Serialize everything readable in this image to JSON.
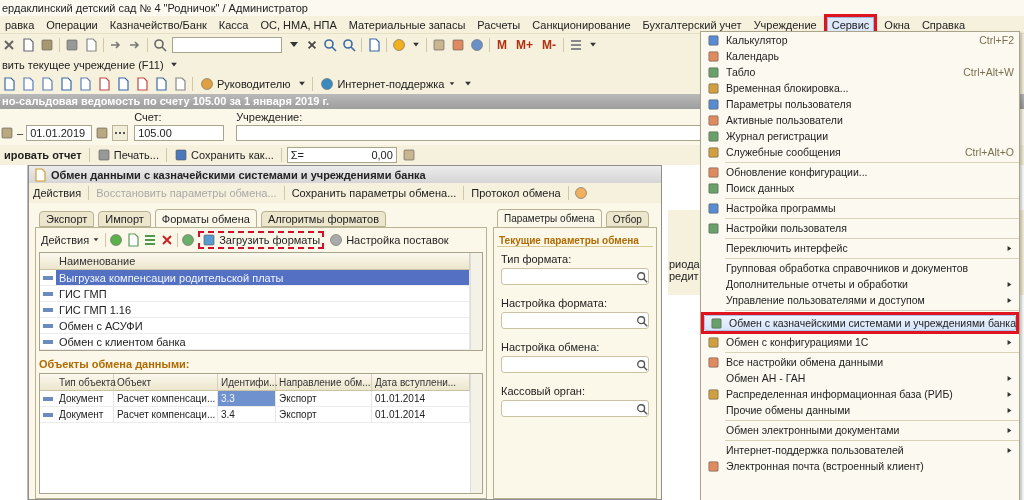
{
  "window": {
    "title": "ердаклинский детский сад № 4 \"Родничок\" / Администратор"
  },
  "menu_bar": [
    {
      "label": "равка",
      "selected": false,
      "annotated": false
    },
    {
      "label": "Операции",
      "selected": false,
      "annotated": false
    },
    {
      "label": "Казначейство/Банк",
      "selected": false,
      "annotated": false
    },
    {
      "label": "Касса",
      "selected": false,
      "annotated": false
    },
    {
      "label": "ОС, НМА, НПА",
      "selected": false,
      "annotated": false
    },
    {
      "label": "Материальные запасы",
      "selected": false,
      "annotated": false
    },
    {
      "label": "Расчеты",
      "selected": false,
      "annotated": false
    },
    {
      "label": "Санкционирование",
      "selected": false,
      "annotated": false
    },
    {
      "label": "Бухгалтерский учет",
      "selected": false,
      "annotated": false
    },
    {
      "label": "Учреждение",
      "selected": false,
      "annotated": false
    },
    {
      "label": "Сервис",
      "selected": true,
      "annotated": true
    },
    {
      "label": "Окна",
      "selected": false,
      "annotated": false
    },
    {
      "label": "Справка",
      "selected": false,
      "annotated": false
    }
  ],
  "toolbar": {
    "memory_buttons": [
      "M",
      "M+",
      "M-"
    ]
  },
  "institution_bar": {
    "label": "вить текущее учреждение (F11)"
  },
  "toolbar_2": {
    "buttons": [
      "Руководителю",
      "Интернет-поддержка"
    ]
  },
  "report": {
    "title": "но-сальдовая ведомость по счету 105.00 за 1 января 2019 г.",
    "period_separator": "–",
    "period_end": "01.01.2019",
    "account_label": "Счет:",
    "account": "105.00",
    "institution_label": "Учреждение:",
    "generate": "ировать отчет",
    "print": "Печать...",
    "save": "Сохранить как...",
    "sum_label": "Σ=",
    "sum": "0,00",
    "columns": [
      "риода",
      "редит"
    ]
  },
  "dialog": {
    "title": "Обмен данными с казначейскими системами и учреждениями банка",
    "toolbar": [
      {
        "label": "Действия",
        "disabled": false
      },
      {
        "label": "Восстановить параметры обмена...",
        "disabled": true
      },
      {
        "label": "Сохранить параметры обмена...",
        "disabled": false
      },
      {
        "label": "Протокол обмена",
        "disabled": false
      }
    ],
    "tabs": [
      {
        "label": "Экспорт",
        "selected": false
      },
      {
        "label": "Импорт",
        "selected": false
      },
      {
        "label": "Форматы обмена",
        "selected": true
      },
      {
        "label": "Алгоритмы форматов",
        "selected": false
      }
    ],
    "formats_toolbar": {
      "actions": "Действия",
      "load": "Загрузить форматы",
      "load_annotated": true,
      "delivery": "Настройка поставок"
    },
    "formats_table": {
      "column": "Наименование",
      "rows": [
        {
          "name": "Выгрузка компенсации родительской платы",
          "selected": true
        },
        {
          "name": "ГИС ГМП",
          "selected": false
        },
        {
          "name": "ГИС ГМП 1.16",
          "selected": false
        },
        {
          "name": "Обмен с АСУФИ",
          "selected": false
        },
        {
          "name": "Обмен с клиентом банка",
          "selected": false
        }
      ]
    },
    "objects_title": "Объекты обмена данными:",
    "objects_table": {
      "columns": [
        "Тип объекта",
        "Объект",
        "Идентифи...",
        "Направление обм...",
        "Дата вступлени..."
      ],
      "rows": [
        {
          "cells": [
            "Документ",
            "Расчет компенсаци...",
            "3.3",
            "Экспорт",
            "01.01.2014"
          ],
          "selected": true
        },
        {
          "cells": [
            "Документ",
            "Расчет компенсаци...",
            "3.4",
            "Экспорт",
            "01.01.2014"
          ],
          "selected": false
        }
      ]
    },
    "side_tabs": [
      {
        "label": "Параметры обмена",
        "selected": true
      },
      {
        "label": "Отбор",
        "selected": false
      }
    ],
    "params_title": "Текущие параметры обмена",
    "params": [
      {
        "label": "Тип формата:"
      },
      {
        "label": "Настройка формата:"
      },
      {
        "label": "Настройка обмена:"
      },
      {
        "label": "Кассовый орган:"
      }
    ]
  },
  "service_menu": {
    "items": [
      {
        "kind": "item",
        "label": "Калькулятор",
        "shortcut": "Ctrl+F2",
        "icon": true,
        "submenu": false,
        "selected": false,
        "annotated": false
      },
      {
        "kind": "item",
        "label": "Календарь",
        "icon": true,
        "submenu": false,
        "selected": false,
        "annotated": false
      },
      {
        "kind": "item",
        "label": "Табло",
        "shortcut": "Ctrl+Alt+W",
        "icon": true,
        "submenu": false,
        "selected": false,
        "annotated": false
      },
      {
        "kind": "item",
        "label": "Временная блокировка...",
        "icon": true,
        "submenu": false,
        "selected": false,
        "annotated": false
      },
      {
        "kind": "item",
        "label": "Параметры пользователя",
        "icon": true,
        "submenu": false,
        "selected": false,
        "annotated": false
      },
      {
        "kind": "item",
        "label": "Активные пользователи",
        "icon": true,
        "submenu": false,
        "selected": false,
        "annotated": false
      },
      {
        "kind": "item",
        "label": "Журнал регистрации",
        "icon": true,
        "submenu": false,
        "selected": false,
        "annotated": false
      },
      {
        "kind": "item",
        "label": "Служебные сообщения",
        "shortcut": "Ctrl+Alt+O",
        "icon": true,
        "submenu": false,
        "selected": false,
        "annotated": false
      },
      {
        "kind": "separator"
      },
      {
        "kind": "item",
        "label": "Обновление конфигурации...",
        "icon": true,
        "submenu": false,
        "selected": false,
        "annotated": false
      },
      {
        "kind": "item",
        "label": "Поиск данных",
        "icon": true,
        "submenu": false,
        "selected": false,
        "annotated": false
      },
      {
        "kind": "separator"
      },
      {
        "kind": "item",
        "label": "Настройка программы",
        "icon": true,
        "submenu": false,
        "selected": false,
        "annotated": false
      },
      {
        "kind": "separator"
      },
      {
        "kind": "item",
        "label": "Настройки пользователя",
        "icon": true,
        "submenu": false,
        "selected": false,
        "annotated": false
      },
      {
        "kind": "separator"
      },
      {
        "kind": "item",
        "label": "Переключить интерфейс",
        "icon": false,
        "submenu": true,
        "selected": false,
        "annotated": false
      },
      {
        "kind": "separator"
      },
      {
        "kind": "item",
        "label": "Групповая обработка справочников и документов",
        "icon": false,
        "submenu": false,
        "selected": false,
        "annotated": false
      },
      {
        "kind": "item",
        "label": "Дополнительные отчеты и обработки",
        "icon": false,
        "submenu": true,
        "selected": false,
        "annotated": false
      },
      {
        "kind": "item",
        "label": "Управление пользователями и доступом",
        "icon": false,
        "submenu": true,
        "selected": false,
        "annotated": false
      },
      {
        "kind": "separator"
      },
      {
        "kind": "item",
        "label": "Обмен с казначейскими системами и учреждениями банка",
        "icon": true,
        "submenu": false,
        "selected": true,
        "annotated": true
      },
      {
        "kind": "item",
        "label": "Обмен с конфигурациями 1С",
        "icon": true,
        "submenu": true,
        "selected": false,
        "annotated": false
      },
      {
        "kind": "separator"
      },
      {
        "kind": "item",
        "label": "Все настройки обмена данными",
        "icon": true,
        "submenu": false,
        "selected": false,
        "annotated": false
      },
      {
        "kind": "item",
        "label": "Обмен АН - ГАН",
        "icon": false,
        "submenu": true,
        "selected": false,
        "annotated": false
      },
      {
        "kind": "item",
        "label": "Распределенная информационная база (РИБ)",
        "icon": true,
        "submenu": true,
        "selected": false,
        "annotated": false
      },
      {
        "kind": "item",
        "label": "Прочие обмены данными",
        "icon": false,
        "submenu": true,
        "selected": false,
        "annotated": false
      },
      {
        "kind": "separator"
      },
      {
        "kind": "item",
        "label": "Обмен электронными документами",
        "icon": false,
        "submenu": true,
        "selected": false,
        "annotated": false
      },
      {
        "kind": "separator"
      },
      {
        "kind": "item",
        "label": "Интернет-поддержка пользователей",
        "icon": false,
        "submenu": true,
        "selected": false,
        "annotated": false
      },
      {
        "kind": "item",
        "label": "Электронная почта (встроенный клиент)",
        "icon": true,
        "submenu": false,
        "selected": false,
        "annotated": false
      }
    ]
  }
}
